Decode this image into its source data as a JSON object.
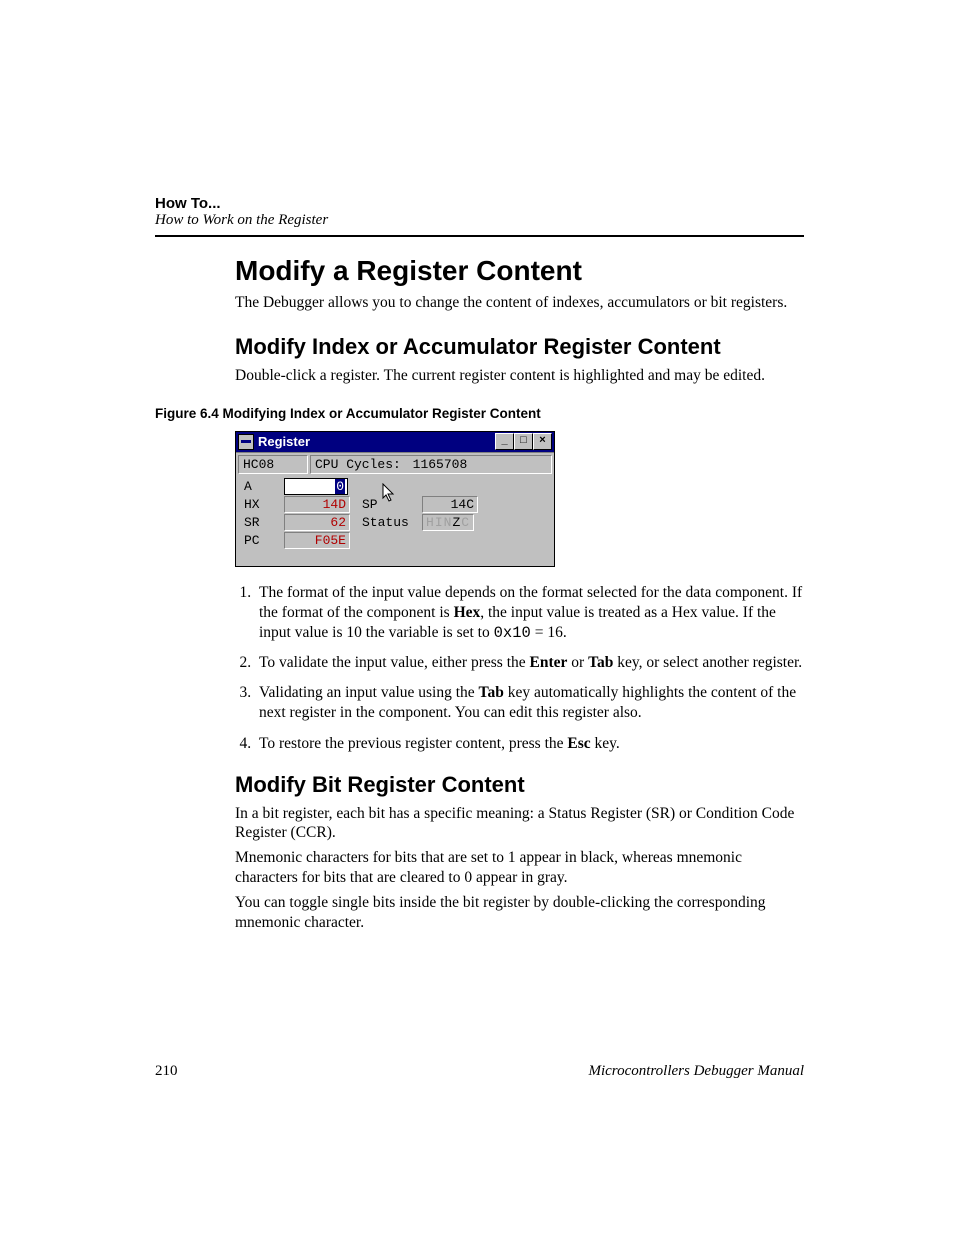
{
  "header": {
    "title": "How To...",
    "subtitle": "How to Work on the Register"
  },
  "section": {
    "title": "Modify a Register Content",
    "intro": "The Debugger allows you to change the content of indexes, accumulators or bit registers."
  },
  "sub1": {
    "title": "Modify Index or Accumulator Register Content",
    "intro": "Double-click a register. The current register content is highlighted and may be edited."
  },
  "figure": {
    "caption": "Figure 6.4  Modifying Index or Accumulator Register Content",
    "window_title": "Register",
    "chip": "HC08",
    "cycles_label": "CPU Cycles:",
    "cycles_value": "1165708",
    "rows": {
      "A": {
        "label": "A",
        "value": "0"
      },
      "HX": {
        "label": "HX",
        "value": "14D"
      },
      "SP": {
        "label": "SP",
        "value": "14C"
      },
      "SR": {
        "label": "SR",
        "value": "62"
      },
      "Status": {
        "label": "Status",
        "flags": [
          "H",
          "I",
          "N",
          "Z",
          "C"
        ],
        "on": "Z"
      },
      "PC": {
        "label": "PC",
        "value": "F05E"
      }
    }
  },
  "steps": {
    "s1a": "The format of the input value depends on the format selected for the data component. If the format of the component is ",
    "s1b_bold": "Hex",
    "s1c": ", the input value is treated as a Hex value. If the input value is 10 the variable is set to ",
    "s1d_mono": "0x10",
    "s1e": " = 16.",
    "s2a": "To validate the input value, either press the ",
    "s2b_bold": "Enter",
    "s2c": " or ",
    "s2d_bold": "Tab",
    "s2e": " key, or select another register.",
    "s3a": "Validating an input value using the ",
    "s3b_bold": "Tab",
    "s3c": " key automatically highlights the content of the next register in the component. You can edit this register also.",
    "s4a": "To restore the previous register content, press the ",
    "s4b_bold": "Esc",
    "s4c": " key."
  },
  "sub2": {
    "title": "Modify Bit Register Content",
    "p1": "In a bit register, each bit has a specific meaning: a Status Register (SR) or Condition Code Register (CCR).",
    "p2": "Mnemonic characters for bits that are set to 1 appear in black, whereas mnemonic characters for bits that are cleared to 0 appear in gray.",
    "p3": "You can toggle single bits inside the bit register by double-clicking the corresponding mnemonic character."
  },
  "footer": {
    "page": "210",
    "manual": "Microcontrollers Debugger Manual"
  }
}
